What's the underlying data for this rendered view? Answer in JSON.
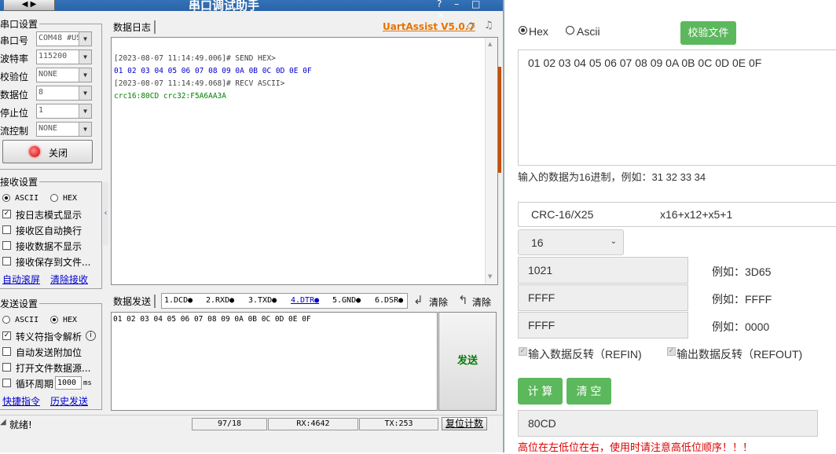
{
  "app": {
    "title": "串口调试助手",
    "window_menu": "◀ ▶",
    "window_controls": "? – □ ×",
    "serial_settings": {
      "group_label": "串口设置",
      "rows": [
        {
          "label": "串口号",
          "value": "COM48 #US"
        },
        {
          "label": "波特率",
          "value": "115200"
        },
        {
          "label": "校验位",
          "value": "NONE"
        },
        {
          "label": "数据位",
          "value": "8"
        },
        {
          "label": "停止位",
          "value": "1"
        },
        {
          "label": "流控制",
          "value": "NONE"
        }
      ],
      "close_button": "关闭"
    },
    "receive_settings": {
      "group_label": "接收设置",
      "radio_ascii": "ASCII",
      "radio_hex": "HEX",
      "options": [
        {
          "label": "按日志模式显示",
          "checked": true
        },
        {
          "label": "接收区自动换行",
          "checked": false
        },
        {
          "label": "接收数据不显示",
          "checked": false
        },
        {
          "label": "接收保存到文件...",
          "checked": false
        }
      ],
      "link_autoscroll": "自动滚屏",
      "link_clear": "清除接收"
    },
    "send_settings": {
      "group_label": "发送设置",
      "radio_ascii": "ASCII",
      "radio_hex": "HEX",
      "options": [
        {
          "label": "转义符指令解析",
          "checked": true
        },
        {
          "label": "自动发送附加位",
          "checked": false
        },
        {
          "label": "打开文件数据源...",
          "checked": false
        },
        {
          "label": "循环周期",
          "checked": false
        }
      ],
      "cycle_value": "1000",
      "cycle_unit": "ms",
      "link_shortcut": "快捷指令",
      "link_history": "历史发送"
    },
    "log": {
      "tab_label": "数据日志",
      "brand": "UartAssist V5.0.7",
      "lines": [
        {
          "text": "[2023-08-07 11:14:49.006]# SEND HEX>",
          "color": "#444444"
        },
        {
          "text": "01 02 03 04 05 06 07 08 09 0A 0B 0C 0D 0E 0F",
          "color": "#0000cc"
        },
        {
          "text": "[2023-08-07 11:14:49.068]# RECV ASCII>",
          "color": "#444444"
        },
        {
          "text": "crc16:80CD   crc32:F5A6AA3A",
          "color": "#008000"
        }
      ]
    },
    "send": {
      "tab_label": "数据发送",
      "signals": [
        "1.DCD●",
        "2.RXD●",
        "3.TXD●",
        "4.DTR●",
        "5.GND●",
        "6.DSR●"
      ],
      "clear1": "清除",
      "clear2": "清除",
      "input_text": "01 02 03 04 05 06 07 08 09 0A 0B 0C 0D 0E 0F",
      "send_button": "发送"
    },
    "status": {
      "ready": "就绪!",
      "ratio": "97/18",
      "rx": "RX:4642",
      "tx": "TX:253",
      "reset": "复位计数"
    }
  },
  "tool": {
    "radio_hex": "Hex",
    "radio_ascii": "Ascii",
    "verify_button": "校验文件",
    "input_value": "01 02 03 04 05 06 07 08 09 0A 0B 0C 0D 0E 0F",
    "input_hint": "输入的数据为16进制，例如：31 32 33 34",
    "algorithm": "CRC-16/X25",
    "polynomial": "x16+x12+x5+1",
    "width_select": "16",
    "params": [
      {
        "value": "1021",
        "example": "例如：3D65"
      },
      {
        "value": "FFFF",
        "example": "例如：FFFF"
      },
      {
        "value": "FFFF",
        "example": "例如：0000"
      }
    ],
    "refin_label": "输入数据反转（REFIN)",
    "refout_label": "输出数据反转（REFOUT)",
    "calc_button": "计 算",
    "clear_button": "清 空",
    "result": "80CD",
    "warning": "高位在左低位在右，使用时请注意高低位顺序！！！",
    "colors": {
      "green": "#5cb85c",
      "warning": "#dd0000"
    }
  }
}
